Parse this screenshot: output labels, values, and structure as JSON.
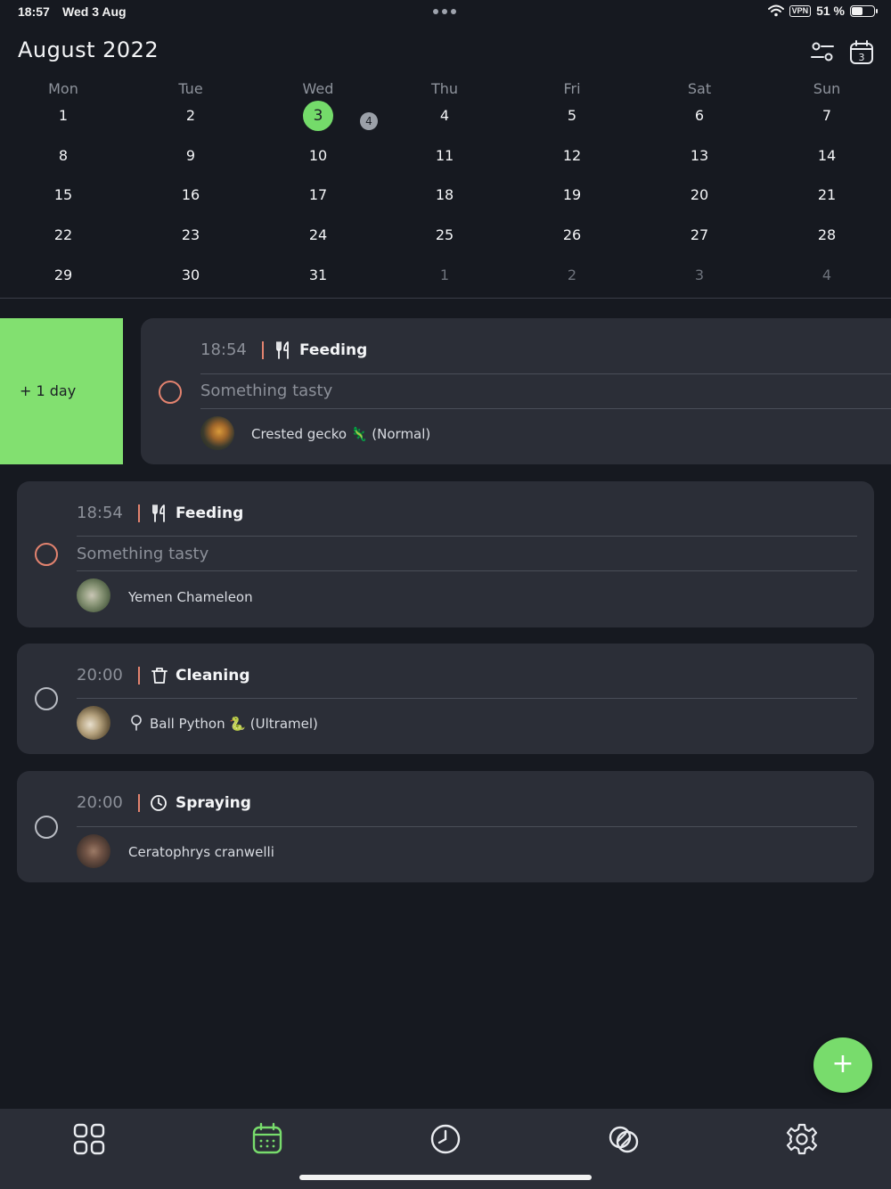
{
  "status_bar": {
    "time": "18:57",
    "date": "Wed 3 Aug",
    "vpn": "VPN",
    "battery": "51 %",
    "battery_level": 0.51
  },
  "calendar": {
    "title": "August 2022",
    "weekdays": [
      "Mon",
      "Tue",
      "Wed",
      "Thu",
      "Fri",
      "Sat",
      "Sun"
    ],
    "weeks": [
      [
        "1",
        "2",
        "3",
        "4",
        "5",
        "6",
        "7"
      ],
      [
        "8",
        "9",
        "10",
        "11",
        "12",
        "13",
        "14"
      ],
      [
        "15",
        "16",
        "17",
        "18",
        "19",
        "20",
        "21"
      ],
      [
        "22",
        "23",
        "24",
        "25",
        "26",
        "27",
        "28"
      ],
      [
        "29",
        "30",
        "31",
        "1",
        "2",
        "3",
        "4"
      ]
    ],
    "today": "3",
    "today_badge": "4"
  },
  "swipe_action": {
    "label": "+ 1 day",
    "color": "#82e070"
  },
  "tasks": [
    {
      "time": "18:54",
      "type": "Feeding",
      "type_icon": "utensils-icon",
      "note": "Something tasty",
      "animal": "Crested gecko 🦎 (Normal)"
    },
    {
      "time": "18:54",
      "type": "Feeding",
      "type_icon": "utensils-icon",
      "note": "Something tasty",
      "animal": "Yemen Chameleon"
    },
    {
      "time": "20:00",
      "type": "Cleaning",
      "type_icon": "trash-icon",
      "animal": "Ball Python 🐍 (Ultramel)"
    },
    {
      "time": "20:00",
      "type": "Spraying",
      "type_icon": "clock-icon",
      "animal": "Ceratophrys cranwelli"
    }
  ],
  "fab": {
    "label": "+"
  },
  "colors": {
    "accent": "#78dc6c",
    "background": "#161920",
    "card": "#2b2e37",
    "status_pending": "#e3836f"
  },
  "nav": [
    "dashboard-icon",
    "calendar-icon",
    "clock-icon",
    "animals-icon",
    "settings-icon"
  ]
}
